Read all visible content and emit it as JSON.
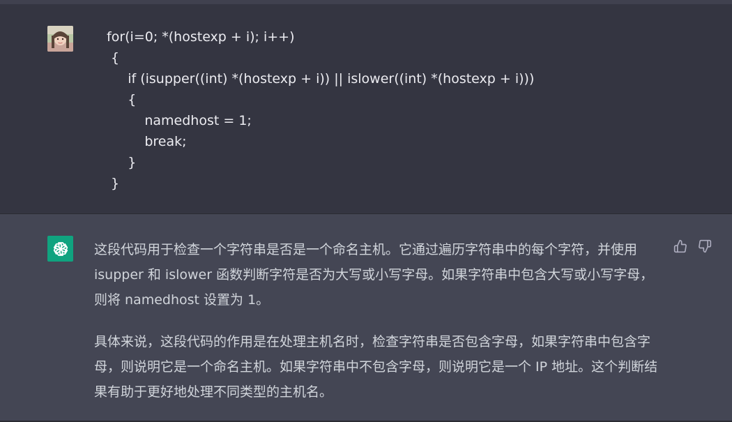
{
  "conversation": {
    "user_message": {
      "avatar": "user-avatar",
      "code_lines": [
        "for(i=0; *(hostexp + i); i++)",
        " {",
        "     if (isupper((int) *(hostexp + i)) || islower((int) *(hostexp + i)))",
        "     {",
        "         namedhost = 1;",
        "         break;",
        "     }",
        " }"
      ]
    },
    "assistant_message": {
      "avatar": "openai-logo-icon",
      "paragraphs": [
        "这段代码用于检查一个字符串是否是一个命名主机。它通过遍历字符串中的每个字符，并使用 isupper 和 islower 函数判断字符是否为大写或小写字母。如果字符串中包含大写或小写字母，则将 namedhost 设置为 1。",
        "具体来说，这段代码的作用是在处理主机名时，检查字符串是否包含字母，如果字符串中包含字母，则说明它是一个命名主机。如果字符串中不包含字母，则说明它是一个 IP 地址。这个判断结果有助于更好地处理不同类型的主机名。"
      ],
      "feedback_icons": [
        "thumbs-up-icon",
        "thumbs-down-icon"
      ]
    }
  },
  "colors": {
    "background": "#343541",
    "assistant_background": "#444654",
    "accent": "#10a37f",
    "text": "#d1d5db"
  }
}
